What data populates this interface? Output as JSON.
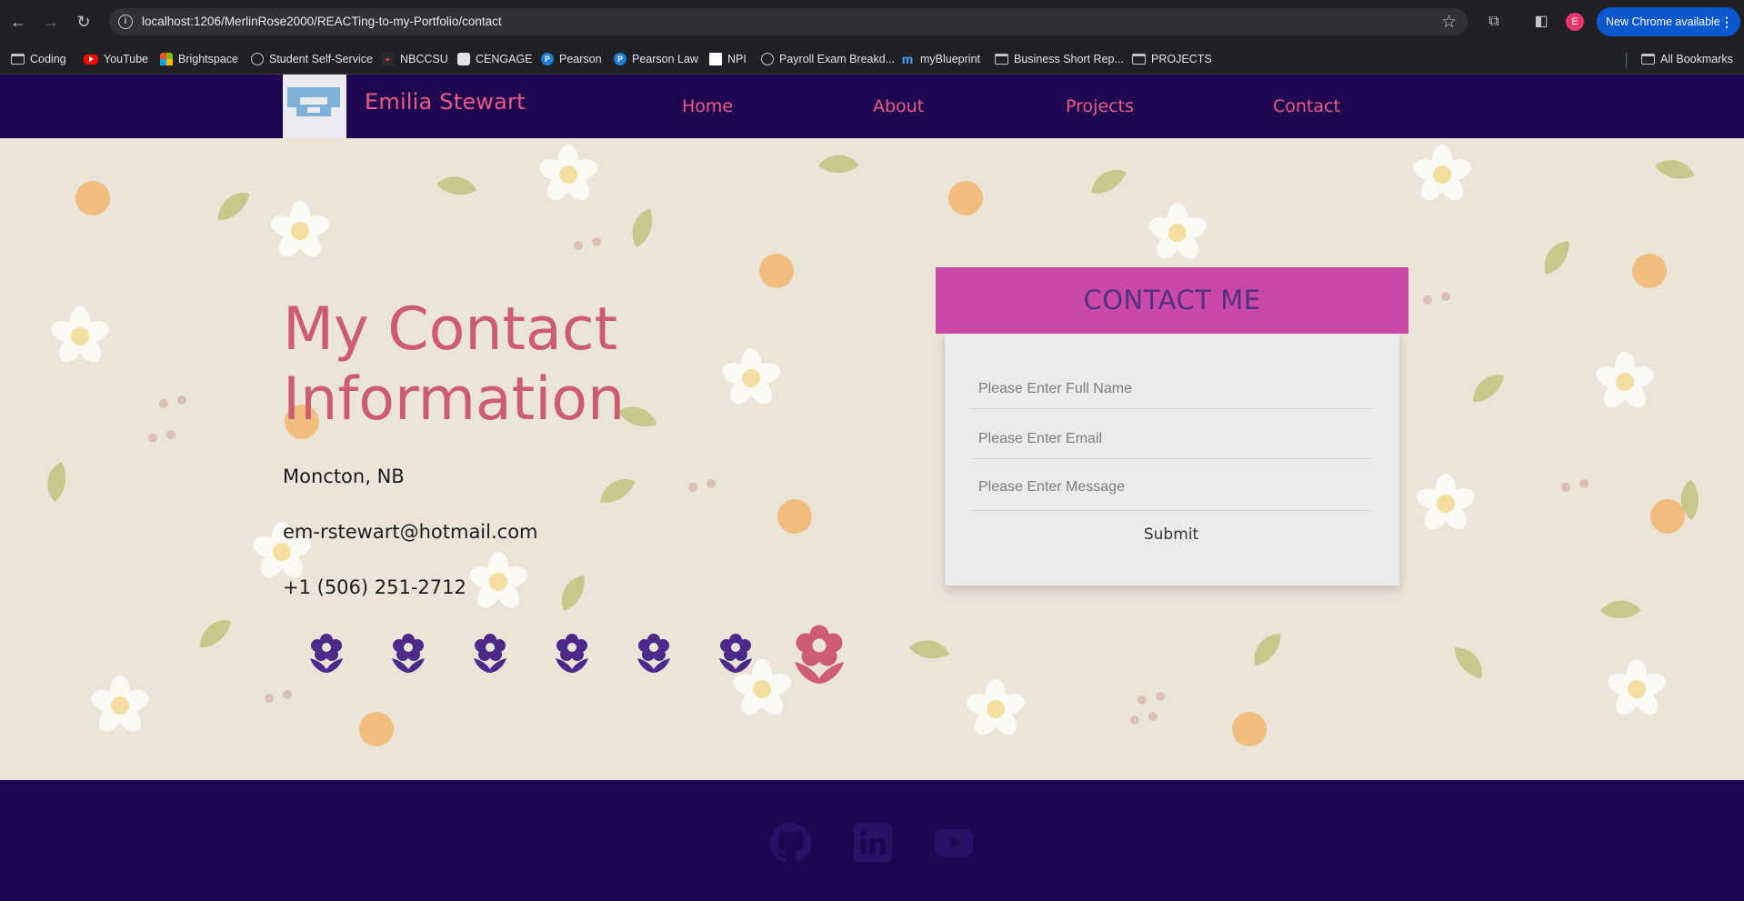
{
  "browser": {
    "url": "localhost:1206/MerlinRose2000/REACTing-to-my-Portfolio/contact",
    "profile_initial": "E",
    "update_label": "New Chrome available",
    "bookmarks": [
      {
        "label": "Coding",
        "icon": "folder-icon"
      },
      {
        "label": "YouTube",
        "icon": "youtube-icon"
      },
      {
        "label": "Brightspace",
        "icon": "microsoft-icon"
      },
      {
        "label": "Student Self-Service",
        "icon": "globe-icon"
      },
      {
        "label": "NBCCSU",
        "icon": "nbccsu-icon"
      },
      {
        "label": "CENGAGE",
        "icon": "cengage-icon"
      },
      {
        "label": "Pearson",
        "icon": "pearson-icon"
      },
      {
        "label": "Pearson Law",
        "icon": "pearson-icon"
      },
      {
        "label": "NPI",
        "icon": "npi-icon"
      },
      {
        "label": "Payroll Exam Breakd...",
        "icon": "globe-icon"
      },
      {
        "label": "myBlueprint",
        "icon": "myblueprint-icon"
      },
      {
        "label": "Business Short Rep...",
        "icon": "folder-icon"
      },
      {
        "label": "PROJECTS",
        "icon": "folder-icon"
      }
    ],
    "all_bookmarks": "All Bookmarks"
  },
  "header": {
    "brand": "Emilia Stewart",
    "nav": [
      "Home",
      "About",
      "Projects",
      "Contact"
    ]
  },
  "contact": {
    "title_line1": "My Contact",
    "title_line2": "Information",
    "location": "Moncton, NB",
    "email": "em-rstewart@hotmail.com",
    "phone": "+1 (506) 251-2712"
  },
  "form": {
    "heading": "CONTACT ME",
    "name_placeholder": "Please Enter Full Name",
    "email_placeholder": "Please Enter Email",
    "message_placeholder": "Please Enter Message",
    "submit_label": "Submit"
  },
  "colors": {
    "nav_bg": "#1e0650",
    "accent_pink": "#ec5a86",
    "heading_rose": "#cd5c72",
    "form_header": "#cb48a6",
    "flower_purple": "#4b2a8a",
    "flower_active": "#cd5c72"
  },
  "footer": {
    "icons": [
      "github-icon",
      "linkedin-icon",
      "youtube-icon"
    ]
  }
}
